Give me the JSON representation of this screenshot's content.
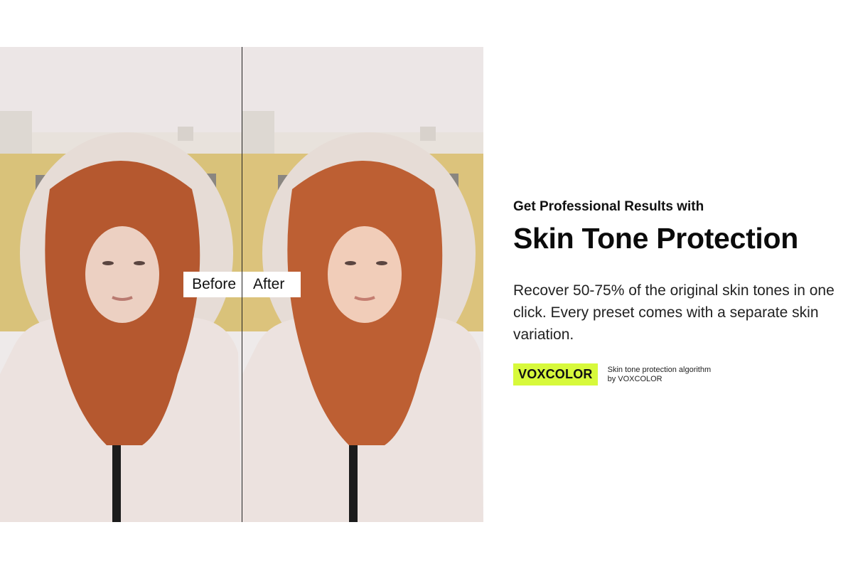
{
  "comparison": {
    "before_label": "Before",
    "after_label": "After"
  },
  "feature": {
    "eyebrow": "Get Professional Results with",
    "headline": "Skin Tone Protection",
    "body": "Recover 50-75% of the original skin tones in one click.  Every preset comes with a separate skin variation."
  },
  "brand": {
    "badge": "VOXCOLOR",
    "caption": "Skin tone protection algorithm by VOXCOLOR"
  },
  "colors": {
    "badge_bg": "#d7f93b",
    "text": "#111111",
    "background": "#ffffff"
  }
}
